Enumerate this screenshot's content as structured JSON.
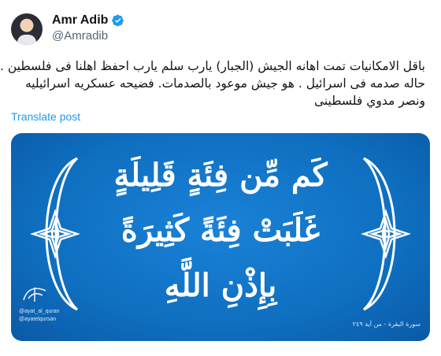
{
  "tweet": {
    "author_name": "Amr Adib",
    "handle": "@Amradib",
    "verified": true,
    "text_lines": [
      "باقل الامكانيات تمت اهانه الجيش (الجبار) يارب سلم يارب احفظ اهلنا فى فلسطين .",
      "حاله صدمه فى اسرائيل . هو جيش موعود بالصدمات. فضيحه عسكريه اسرائيليه",
      "ونصر مدوي فلسطينى"
    ],
    "translate_label": "Translate post"
  },
  "image_card": {
    "verse_lines": [
      "كَم مِّن فِئَةٍ قَلِيلَةٍ",
      "غَلَبَتْ فِئَةً كَثِيرَةً",
      "بِإِذْنِ اللَّهِ"
    ],
    "social_handles": [
      "@ayat_al_quran",
      "@ayatelqursan"
    ],
    "source": "سورة البقرة - من آية ٢٤٩",
    "background_color": "#1172c4",
    "text_color": "#ffffff"
  },
  "colors": {
    "link": "#1d9bf0",
    "verified_badge": "#1d9bf0",
    "text_primary": "#0f1419",
    "text_secondary": "#536471"
  }
}
